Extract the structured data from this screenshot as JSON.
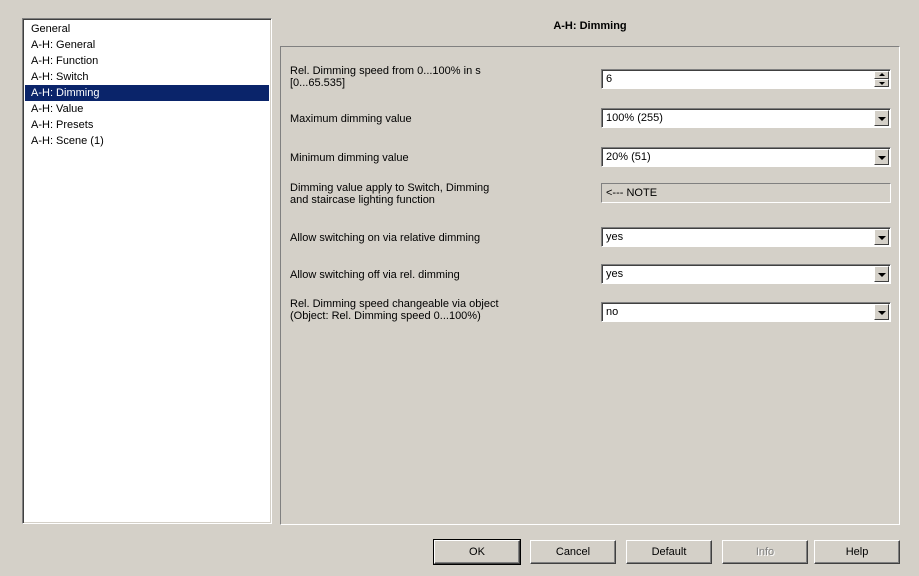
{
  "sidebar": {
    "items": [
      {
        "label": "General",
        "selected": false
      },
      {
        "label": "A-H: General",
        "selected": false
      },
      {
        "label": "A-H: Function",
        "selected": false
      },
      {
        "label": "A-H: Switch",
        "selected": false
      },
      {
        "label": "A-H: Dimming",
        "selected": true
      },
      {
        "label": "A-H: Value",
        "selected": false
      },
      {
        "label": "A-H: Presets",
        "selected": false
      },
      {
        "label": "A-H: Scene (1)",
        "selected": false
      }
    ]
  },
  "page": {
    "title": "A-H: Dimming"
  },
  "params": [
    {
      "line1": "Rel. Dimming speed from 0...100% in s",
      "line2": "[0...65.535]",
      "value": "6",
      "control": "spinner"
    },
    {
      "line1": "Maximum dimming value",
      "line2": "",
      "value": "100% (255)",
      "control": "dropdown"
    },
    {
      "line1": "Minimum dimming value",
      "line2": "",
      "value": "20%  (51)",
      "control": "dropdown"
    },
    {
      "line1": "Dimming value apply to Switch, Dimming",
      "line2": "and staircase lighting function",
      "value": "<--- NOTE",
      "control": "readonly"
    },
    {
      "line1": "Allow switching on via relative dimming",
      "line2": "",
      "value": "yes",
      "control": "dropdown"
    },
    {
      "line1": "Allow switching off via rel. dimming",
      "line2": "",
      "value": "yes",
      "control": "dropdown"
    },
    {
      "line1": "Rel. Dimming speed changeable via object",
      "line2": "(Object: Rel. Dimming speed 0...100%)",
      "value": "no",
      "control": "dropdown"
    }
  ],
  "buttons": {
    "ok": "OK",
    "cancel": "Cancel",
    "default": "Default",
    "info": "Info",
    "help": "Help"
  },
  "colors": {
    "window_bg": "#d4d0c8",
    "selection": "#0a246a"
  }
}
